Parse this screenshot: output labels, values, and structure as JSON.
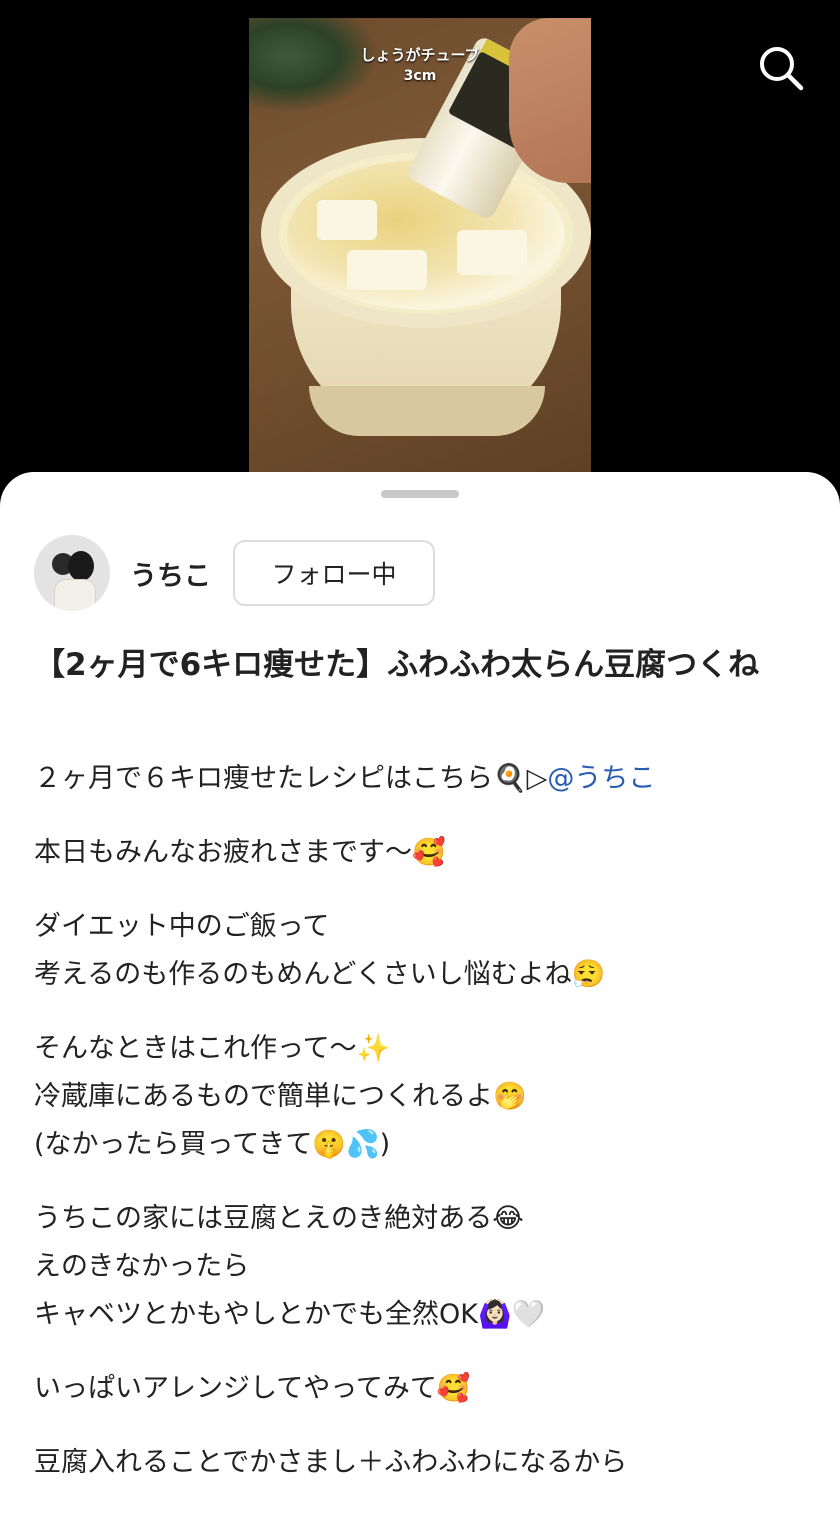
{
  "video": {
    "caption_line1": "しょうがチューブ",
    "caption_line2": "3cm"
  },
  "header": {
    "search_icon": "search-icon"
  },
  "author": {
    "name": "うちこ",
    "follow_label": "フォロー中"
  },
  "post": {
    "title": "【2ヶ月で6キロ痩せた】ふわふわ太らん豆腐つくね",
    "intro_text": "２ヶ月で６キロ痩せたレシピはこちら🍳▷",
    "intro_mention": "@うちこ",
    "paragraphs": [
      [
        "本日もみんなお疲れさまです〜🥰"
      ],
      [
        "ダイエット中のご飯って",
        "考えるのも作るのもめんどくさいし悩むよね😮‍💨"
      ],
      [
        "そんなときはこれ作って〜✨",
        "冷蔵庫にあるもので簡単につくれるよ🤭",
        "(なかったら買ってきて🤫💦)"
      ],
      [
        "うちこの家には豆腐とえのき絶対ある😂",
        "えのきなかったら",
        "キャベツとかもやしとかでも全然OK🙆🏻‍♀️🤍"
      ],
      [
        "いっぱいアレンジしてやってみて🥰"
      ],
      [
        "豆腐入れることでかさまし＋ふわふわになるから"
      ]
    ]
  }
}
